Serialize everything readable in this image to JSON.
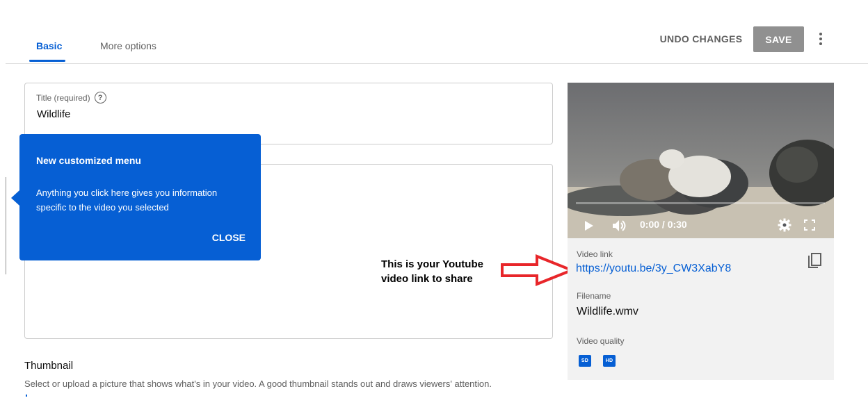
{
  "tabs": [
    {
      "label": "Basic",
      "active": true
    },
    {
      "label": "More options",
      "active": false
    }
  ],
  "toolbar": {
    "undo_label": "UNDO CHANGES",
    "save_label": "SAVE",
    "menu_icon": "more-vert-icon"
  },
  "title_field": {
    "label": "Title (required)",
    "help_icon": "help-circle-icon",
    "help_glyph": "?",
    "value": "Wildlife"
  },
  "tooltip": {
    "title": "New customized menu",
    "body": "Anything you click here gives you information specific to the video you selected",
    "close_label": "CLOSE"
  },
  "annotation": {
    "text": "This is your Youtube video link to share",
    "arrow_color": "#e8262a"
  },
  "video": {
    "time": "0:00 / 0:30",
    "link_label": "Video link",
    "link": "https://youtu.be/3y_CW3XabY8",
    "filename_label": "Filename",
    "filename": "Wildlife.wmv",
    "quality_label": "Video quality",
    "quality_badges": [
      "SD",
      "HD"
    ]
  },
  "thumbnail": {
    "title": "Thumbnail",
    "description": "Select or upload a picture that shows what's in your video. A good thumbnail stands out and draws viewers' attention."
  },
  "colors": {
    "accent": "#065fd4",
    "save_bg": "#909090",
    "card_bg": "#f2f2f2"
  }
}
